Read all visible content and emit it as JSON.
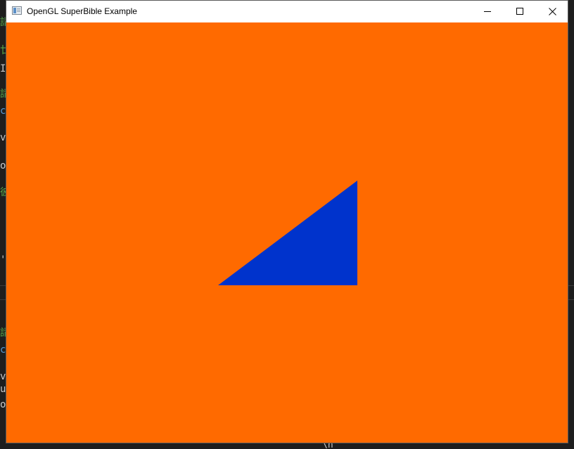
{
  "window": {
    "title": "OpenGL SuperBible Example",
    "icon": "app-window-icon",
    "controls": {
      "minimize": "minimize-icon",
      "maximize": "maximize-icon",
      "close": "close-icon"
    }
  },
  "canvas": {
    "clear_color": "#ff6a00",
    "triangle_color": "#0033cc",
    "triangle_shape": "right-triangle"
  },
  "background": {
    "bottom_text": "\\n"
  }
}
